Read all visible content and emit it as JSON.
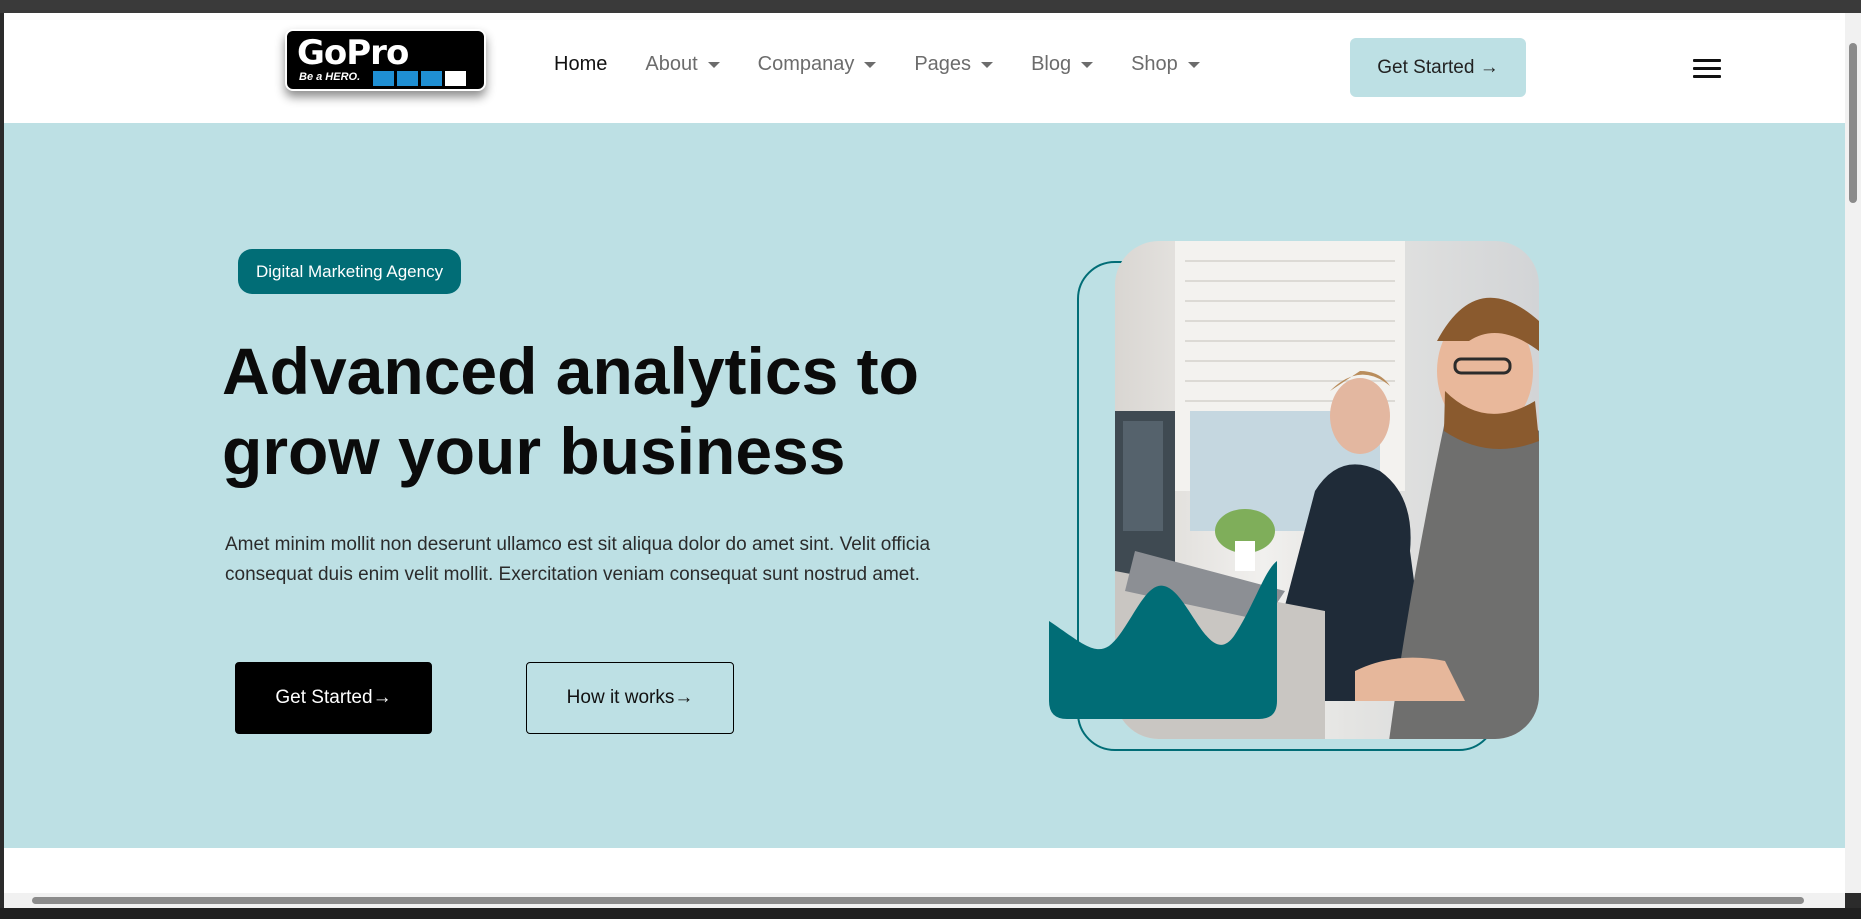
{
  "brand": {
    "logo_text": "GoPro",
    "logo_tagline": "Be a HERO.",
    "colors": {
      "accent": "#016d76",
      "hero_bg": "#bde0e4",
      "nav_btn_bg": "#bde0e4"
    }
  },
  "nav": {
    "items": [
      {
        "label": "Home",
        "active": true,
        "dropdown": false
      },
      {
        "label": "About",
        "active": false,
        "dropdown": true
      },
      {
        "label": "Companay",
        "active": false,
        "dropdown": true
      },
      {
        "label": "Pages",
        "active": false,
        "dropdown": true
      },
      {
        "label": "Blog",
        "active": false,
        "dropdown": true
      },
      {
        "label": "Shop",
        "active": false,
        "dropdown": true
      }
    ],
    "cta_label": "Get Started →",
    "menu_icon": "hamburger-icon"
  },
  "hero": {
    "badge": "Digital Marketing Agency",
    "title_line1": "Advanced analytics to",
    "title_line2": "grow your business",
    "description_line1": "Amet minim mollit non deserunt ullamco est sit aliqua dolor do amet sint. Velit officia",
    "description_line2": "consequat duis enim velit mollit. Exercitation veniam consequat sunt nostrud amet.",
    "primary_button": "Get Started→",
    "secondary_button": "How it works→"
  }
}
